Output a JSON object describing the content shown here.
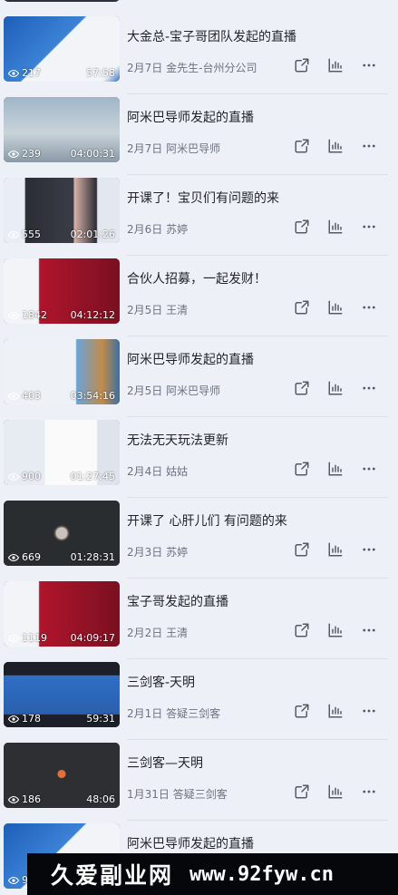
{
  "items": [
    {
      "title": "大金总-宝子哥团队发起的直播",
      "date": "2月7日",
      "author": "金先生-台州分公司",
      "views": "217",
      "duration": "57:58",
      "thumb": "desktop-blue"
    },
    {
      "title": "阿米巴导师发起的直播",
      "date": "2月7日",
      "author": "阿米巴导师",
      "views": "239",
      "duration": "04:00:31",
      "thumb": "penguin"
    },
    {
      "title": "开课了！宝贝们有问题的来",
      "date": "2月6日",
      "author": "苏婷",
      "views": "555",
      "duration": "02:01:26",
      "thumb": "dark-app"
    },
    {
      "title": "合伙人招募，一起发财！",
      "date": "2月5日",
      "author": "王清",
      "views": "1842",
      "duration": "04:12:12",
      "thumb": "red-stage"
    },
    {
      "title": "阿米巴导师发起的直播",
      "date": "2月5日",
      "author": "阿米巴导师",
      "views": "403",
      "duration": "03:54:16",
      "thumb": "desktop-landscape"
    },
    {
      "title": "无法无天玩法更新",
      "date": "2月4日",
      "author": "姑姑",
      "views": "900",
      "duration": "01:27:45",
      "thumb": "doc-window"
    },
    {
      "title": "开课了 心肝儿们 有问题的来",
      "date": "2月3日",
      "author": "苏婷",
      "views": "669",
      "duration": "01:28:31",
      "thumb": "dark-avatar"
    },
    {
      "title": "宝子哥发起的直播",
      "date": "2月2日",
      "author": "王清",
      "views": "1119",
      "duration": "04:09:17",
      "thumb": "red-stage"
    },
    {
      "title": "三剑客-天明",
      "date": "2月1日",
      "author": "答疑三剑客",
      "views": "178",
      "duration": "59:31",
      "thumb": "blue-window"
    },
    {
      "title": "三剑客—天明",
      "date": "1月31日",
      "author": "答疑三剑客",
      "views": "186",
      "duration": "48:06",
      "thumb": "dark-dot"
    },
    {
      "title": "阿米巴导师发起的直播",
      "date": "",
      "author": "",
      "views": "916",
      "duration": "",
      "thumb": "desktop-blue"
    }
  ],
  "icons": {
    "views": "eye-icon",
    "share": "share-icon",
    "stats": "bar-chart-icon",
    "more": "more-icon"
  },
  "watermark": {
    "cn": "久爱副业网",
    "url": "www.92fyw.cn"
  }
}
